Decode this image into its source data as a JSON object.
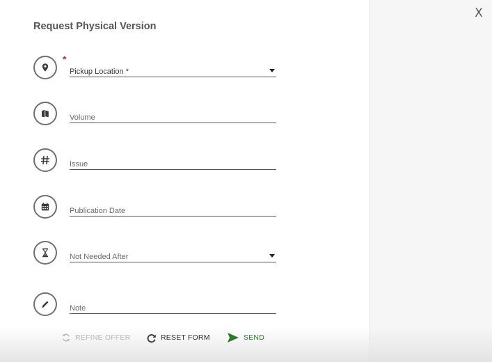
{
  "dialog": {
    "title": "Request Physical Version",
    "close_label": "X"
  },
  "fields": [
    {
      "label": "Pickup Location *",
      "required": true,
      "type": "select",
      "icon": "location-pin-icon"
    },
    {
      "label": "Volume",
      "required": false,
      "type": "text",
      "icon": "books-icon"
    },
    {
      "label": "Issue",
      "required": false,
      "type": "text",
      "icon": "hash-icon"
    },
    {
      "label": "Publication Date",
      "required": false,
      "type": "text",
      "icon": "calendar-icon"
    },
    {
      "label": "Not Needed After",
      "required": false,
      "type": "select",
      "icon": "hourglass-icon"
    },
    {
      "label": "Note",
      "required": false,
      "type": "text",
      "icon": "pencil-icon"
    }
  ],
  "required_marker": "*",
  "actions": {
    "refine_label": "REFINE OFFER",
    "reset_label": "RESET FORM",
    "send_label": "SEND"
  },
  "colors": {
    "required": "#c9302c",
    "send": "#2d7a2d",
    "disabled": "#b8b8b8",
    "icon_border": "#707070",
    "right_panel_bg": "#f6f6f6"
  }
}
